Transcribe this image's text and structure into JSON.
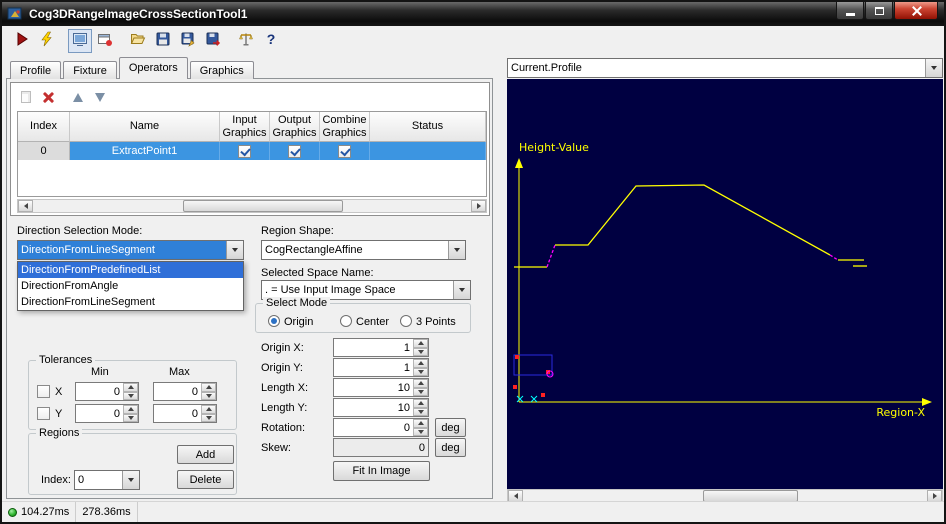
{
  "window": {
    "title": "Cog3DRangeImageCrossSectionTool1"
  },
  "toolbar": {
    "icons": [
      "run",
      "live-run",
      "image-display",
      "new-image-window",
      "open-file",
      "save",
      "save-as",
      "export",
      "measure",
      "help"
    ],
    "help_glyph": "?"
  },
  "tabs": [
    "Profile",
    "Fixture",
    "Operators",
    "Graphics"
  ],
  "operator_grid": {
    "columns": [
      "Index",
      "Name",
      "Input\nGraphics",
      "Output\nGraphics",
      "Combine\nGraphics",
      "Status"
    ],
    "row": {
      "index": "0",
      "name": "ExtractPoint1",
      "input_checked": true,
      "output_checked": true,
      "combine_checked": true,
      "status": ""
    }
  },
  "direction": {
    "label": "Direction Selection Mode:",
    "value": "DirectionFromLineSegment",
    "options": [
      "DirectionFromPredefinedList",
      "DirectionFromAngle",
      "DirectionFromLineSegment"
    ],
    "highlighted_index": 0
  },
  "region": {
    "shape_label": "Region Shape:",
    "shape_value": "CogRectangleAffine",
    "space_label": "Selected Space Name:",
    "space_value": ". = Use Input Image Space",
    "select_mode": {
      "label": "Select Mode",
      "options": [
        "Origin",
        "Center",
        "3 Points"
      ],
      "selected": "Origin"
    },
    "fields": [
      {
        "label": "Origin X:",
        "value": "1"
      },
      {
        "label": "Origin Y:",
        "value": "1"
      },
      {
        "label": "Length X:",
        "value": "10"
      },
      {
        "label": "Length Y:",
        "value": "10"
      },
      {
        "label": "Rotation:",
        "value": "0",
        "unit": "deg"
      },
      {
        "label": "Skew:",
        "value": "0",
        "unit": "deg"
      }
    ],
    "fit_button": "Fit In Image"
  },
  "tolerances": {
    "title": "Tolerances",
    "min": "Min",
    "max": "Max",
    "rows": [
      {
        "label": "X",
        "checked": false,
        "min": "0",
        "max": "0"
      },
      {
        "label": "Y",
        "checked": false,
        "min": "0",
        "max": "0"
      }
    ]
  },
  "regions": {
    "title": "Regions",
    "add": "Add",
    "delete": "Delete",
    "index_label": "Index:",
    "index_value": "0"
  },
  "profile": {
    "selector": "Current.Profile",
    "ylabel": "Height-Value",
    "xlabel": "Region-X",
    "colors": {
      "background": "#000041",
      "axis": "#ffff00",
      "trace": "#ffff00",
      "overlay": "#ff00ff",
      "marker": "#ff2222",
      "cross": "#00ffff",
      "rect": "#2a2ae0"
    },
    "segments": [
      {
        "color": "#ffff00",
        "points": [
          [
            7,
            188
          ],
          [
            40,
            188
          ]
        ]
      },
      {
        "color": "#ff00ff",
        "dash": "3,2",
        "points": [
          [
            40,
            188
          ],
          [
            48,
            166
          ]
        ]
      },
      {
        "color": "#ffff00",
        "points": [
          [
            48,
            166
          ],
          [
            81,
            166
          ],
          [
            129,
            107
          ],
          [
            197,
            106
          ],
          [
            323,
            176
          ]
        ]
      },
      {
        "color": "#ff00ff",
        "dash": "3,2",
        "points": [
          [
            323,
            176
          ],
          [
            331,
            181
          ]
        ]
      },
      {
        "color": "#ffff00",
        "points": [
          [
            331,
            181
          ],
          [
            357,
            181
          ]
        ]
      },
      {
        "color": "#ffff00",
        "points": [
          [
            346,
            187
          ],
          [
            360,
            187
          ]
        ]
      }
    ],
    "markers": {
      "red_squares": [
        [
          10,
          278
        ],
        [
          41,
          293
        ],
        [
          8,
          308
        ],
        [
          36,
          316
        ]
      ],
      "magenta_circle": [
        43,
        295
      ],
      "cyan_crosses": [
        [
          13,
          320
        ],
        [
          27,
          320
        ]
      ],
      "blue_rect": [
        7,
        276,
        38,
        20
      ]
    }
  },
  "status": {
    "run_time": "104.27ms",
    "total_time": "278.36ms"
  }
}
